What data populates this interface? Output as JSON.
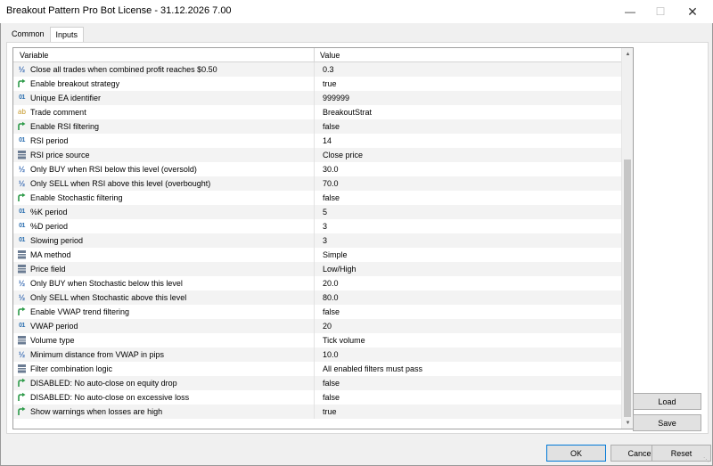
{
  "window": {
    "title": "Breakout Pattern Pro Bot License - 31.12.2026 7.00",
    "minimize_glyph": "—",
    "maximize_glyph": "☐",
    "close_glyph": "✕"
  },
  "tabs": [
    {
      "label": "Common",
      "active": false
    },
    {
      "label": "Inputs",
      "active": true
    }
  ],
  "grid": {
    "col_variable": "Variable",
    "col_value": "Value",
    "rows": [
      {
        "type": "double",
        "icon": "double-icon",
        "variable": "Close all trades when combined profit reaches $0.50",
        "value": "0.3"
      },
      {
        "type": "bool",
        "icon": "bool-arrow-icon",
        "variable": "Enable breakout strategy",
        "value": "true"
      },
      {
        "type": "int",
        "icon": "int-icon",
        "variable": "Unique EA identifier",
        "value": "999999"
      },
      {
        "type": "string",
        "icon": "string-icon",
        "variable": "Trade comment",
        "value": "BreakoutStrat"
      },
      {
        "type": "bool",
        "icon": "bool-arrow-icon",
        "variable": "Enable RSI filtering",
        "value": "false"
      },
      {
        "type": "int",
        "icon": "int-icon",
        "variable": "RSI period",
        "value": "14"
      },
      {
        "type": "enum",
        "icon": "enum-icon",
        "variable": "RSI price source",
        "value": "Close price"
      },
      {
        "type": "double",
        "icon": "double-icon",
        "variable": "Only BUY when RSI below this level (oversold)",
        "value": "30.0"
      },
      {
        "type": "double",
        "icon": "double-icon",
        "variable": "Only SELL when RSI above this level (overbought)",
        "value": "70.0"
      },
      {
        "type": "bool",
        "icon": "bool-arrow-icon",
        "variable": "Enable Stochastic filtering",
        "value": "false"
      },
      {
        "type": "int",
        "icon": "int-icon",
        "variable": "%K period",
        "value": "5"
      },
      {
        "type": "int",
        "icon": "int-icon",
        "variable": "%D period",
        "value": "3"
      },
      {
        "type": "int",
        "icon": "int-icon",
        "variable": "Slowing period",
        "value": "3"
      },
      {
        "type": "enum",
        "icon": "enum-icon",
        "variable": "MA method",
        "value": "Simple"
      },
      {
        "type": "enum",
        "icon": "enum-icon",
        "variable": "Price field",
        "value": "Low/High"
      },
      {
        "type": "double",
        "icon": "double-icon",
        "variable": "Only BUY when Stochastic below this level",
        "value": "20.0"
      },
      {
        "type": "double",
        "icon": "double-icon",
        "variable": "Only SELL when Stochastic above this level",
        "value": "80.0"
      },
      {
        "type": "bool",
        "icon": "bool-arrow-icon",
        "variable": "Enable VWAP trend filtering",
        "value": "false"
      },
      {
        "type": "int",
        "icon": "int-icon",
        "variable": "VWAP period",
        "value": "20"
      },
      {
        "type": "enum",
        "icon": "enum-icon",
        "variable": "Volume type",
        "value": "Tick volume"
      },
      {
        "type": "double",
        "icon": "double-icon",
        "variable": "Minimum distance from VWAP in pips",
        "value": "10.0"
      },
      {
        "type": "enum",
        "icon": "enum-icon",
        "variable": "Filter combination logic",
        "value": "All enabled filters must pass"
      },
      {
        "type": "bool",
        "icon": "bool-arrow-icon",
        "variable": "DISABLED: No auto-close on equity drop",
        "value": "false"
      },
      {
        "type": "bool",
        "icon": "bool-arrow-icon",
        "variable": "DISABLED: No auto-close on excessive loss",
        "value": "false"
      },
      {
        "type": "bool",
        "icon": "bool-arrow-icon",
        "variable": "Show warnings when losses are high",
        "value": "true"
      }
    ]
  },
  "scroll": {
    "position_fraction": 0.28,
    "visible_fraction": 0.72
  },
  "buttons": {
    "load": "Load",
    "save": "Save",
    "ok": "OK",
    "cancel": "Cancel",
    "reset": "Reset"
  },
  "colors": {
    "double_icon": "#3e6fb5",
    "int_icon": "#2c6fb0",
    "string_icon": "#c79a2b",
    "bool_icon": "#2e9b4a",
    "enum_icon": "#6b7c93",
    "default_button_border": "#0078d7"
  }
}
